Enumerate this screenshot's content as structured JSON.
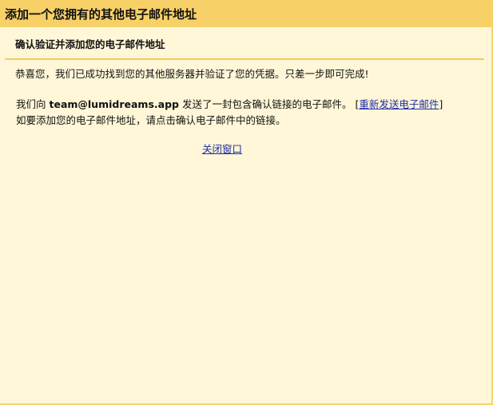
{
  "dialog": {
    "title": "添加一个您拥有的其他电子邮件地址",
    "section_title": "确认验证并添加您的电子邮件地址",
    "success_message": "恭喜您，我们已成功找到您的其他服务器并验证了您的凭据。只差一步即可完成!",
    "email_notice_prefix": "我们向 ",
    "email_address": "team@lumidreams.app",
    "email_notice_suffix": " 发送了一封包含确认链接的电子邮件。",
    "resend_open": "[",
    "resend_label": "重新发送电子邮件",
    "resend_close": "]",
    "instruction": "如要添加您的电子邮件地址，请点击确认电子邮件中的链接。",
    "close_label": "关闭窗口"
  }
}
